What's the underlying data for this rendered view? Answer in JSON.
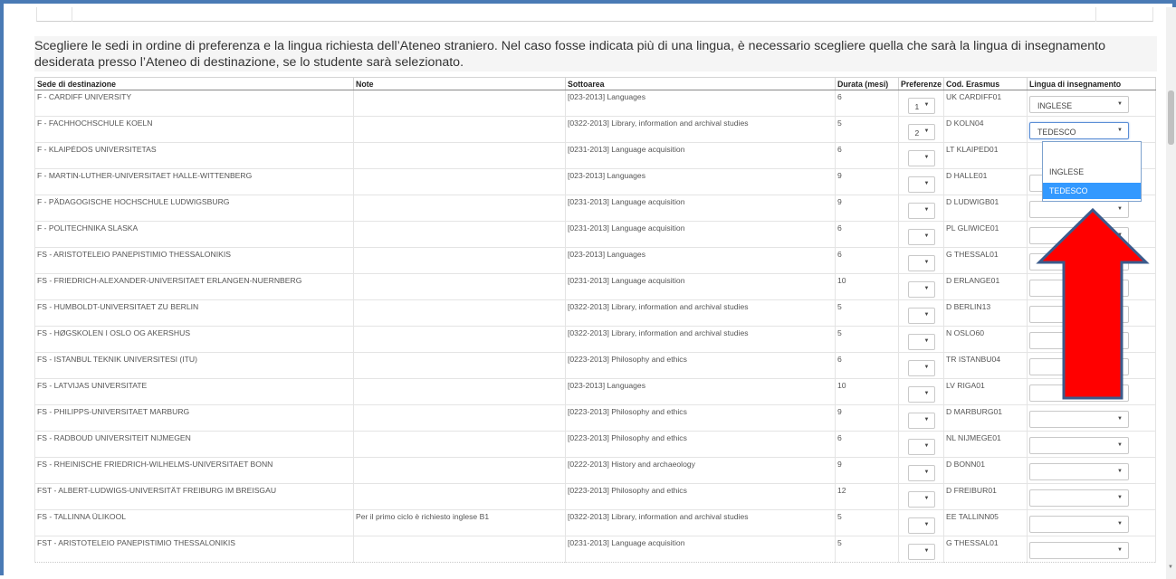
{
  "instructions": "Scegliere le sedi in ordine di preferenza e la lingua richiesta dell’Ateneo straniero. Nel caso fosse indicata più di una lingua, è necessario scegliere quella che sarà la lingua di insegnamento desiderata presso l’Ateneo di destinazione, se lo studente sarà selezionato.",
  "table": {
    "headers": {
      "sede": "Sede di destinazione",
      "note": "Note",
      "sottoarea": "Sottoarea",
      "durata": "Durata (mesi)",
      "preferenze": "Preferenze",
      "cod": "Cod. Erasmus",
      "lingua": "Lingua di insegnamento"
    },
    "rows": [
      {
        "sede": "F - CARDIFF UNIVERSITY",
        "note": "",
        "sottoarea": "[023-2013] Languages",
        "durata": "6",
        "pref": "1",
        "cod": "UK CARDIFF01",
        "lingua": "INGLESE"
      },
      {
        "sede": "F - FACHHOCHSCHULE KOELN",
        "note": "",
        "sottoarea": "[0322-2013] Library, information and archival studies",
        "durata": "5",
        "pref": "2",
        "cod": "D KOLN04",
        "lingua": "TEDESCO"
      },
      {
        "sede": "F - KLAIPĖDOS UNIVERSITETAS",
        "note": "",
        "sottoarea": "[0231-2013] Language acquisition",
        "durata": "6",
        "pref": "",
        "cod": "LT KLAIPED01",
        "lingua": ""
      },
      {
        "sede": "F - MARTIN-LUTHER-UNIVERSITAET HALLE-WITTENBERG",
        "note": "",
        "sottoarea": "[023-2013] Languages",
        "durata": "9",
        "pref": "",
        "cod": "D HALLE01",
        "lingua": ""
      },
      {
        "sede": "F - PÄDAGOGISCHE HOCHSCHULE LUDWIGSBURG",
        "note": "",
        "sottoarea": "[0231-2013] Language acquisition",
        "durata": "9",
        "pref": "",
        "cod": "D LUDWIGB01",
        "lingua": ""
      },
      {
        "sede": "F - POLITECHNIKA SLASKA",
        "note": "",
        "sottoarea": "[0231-2013] Language acquisition",
        "durata": "6",
        "pref": "",
        "cod": "PL GLIWICE01",
        "lingua": ""
      },
      {
        "sede": "FS - ARISTOTELEIO PANEPISTIMIO THESSALONIKIS",
        "note": "",
        "sottoarea": "[023-2013] Languages",
        "durata": "6",
        "pref": "",
        "cod": "G THESSAL01",
        "lingua": ""
      },
      {
        "sede": "FS - FRIEDRICH-ALEXANDER-UNIVERSITAET ERLANGEN-NUERNBERG",
        "note": "",
        "sottoarea": "[0231-2013] Language acquisition",
        "durata": "10",
        "pref": "",
        "cod": "D ERLANGE01",
        "lingua": ""
      },
      {
        "sede": "FS - HUMBOLDT-UNIVERSITAET ZU BERLIN",
        "note": "",
        "sottoarea": "[0322-2013] Library, information and archival studies",
        "durata": "5",
        "pref": "",
        "cod": "D BERLIN13",
        "lingua": ""
      },
      {
        "sede": "FS - HØGSKOLEN I OSLO OG AKERSHUS",
        "note": "",
        "sottoarea": "[0322-2013] Library, information and archival studies",
        "durata": "5",
        "pref": "",
        "cod": "N OSLO60",
        "lingua": ""
      },
      {
        "sede": "FS - ISTANBUL TEKNIK UNIVERSITESI (ITU)",
        "note": "",
        "sottoarea": "[0223-2013] Philosophy and ethics",
        "durata": "6",
        "pref": "",
        "cod": "TR ISTANBU04",
        "lingua": ""
      },
      {
        "sede": "FS - LATVIJAS UNIVERSITATE",
        "note": "",
        "sottoarea": "[023-2013] Languages",
        "durata": "10",
        "pref": "",
        "cod": "LV RIGA01",
        "lingua": ""
      },
      {
        "sede": "FS - PHILIPPS-UNIVERSITAET MARBURG",
        "note": "",
        "sottoarea": "[0223-2013] Philosophy and ethics",
        "durata": "9",
        "pref": "",
        "cod": "D MARBURG01",
        "lingua": ""
      },
      {
        "sede": "FS - RADBOUD UNIVERSITEIT NIJMEGEN",
        "note": "",
        "sottoarea": "[0223-2013] Philosophy and ethics",
        "durata": "6",
        "pref": "",
        "cod": "NL NIJMEGE01",
        "lingua": ""
      },
      {
        "sede": "FS - RHEINISCHE FRIEDRICH-WILHELMS-UNIVERSITAET BONN",
        "note": "",
        "sottoarea": "[0222-2013] History and archaeology",
        "durata": "9",
        "pref": "",
        "cod": "D BONN01",
        "lingua": ""
      },
      {
        "sede": "FST - ALBERT-LUDWIGS-UNIVERSITÄT FREIBURG IM BREISGAU",
        "note": "",
        "sottoarea": "[0223-2013] Philosophy and ethics",
        "durata": "12",
        "pref": "",
        "cod": "D FREIBUR01",
        "lingua": ""
      },
      {
        "sede": "FS - TALLINNA ÜLIKOOL",
        "note": "Per il primo ciclo è richiesto inglese B1",
        "sottoarea": "[0322-2013] Library, information and archival studies",
        "durata": "5",
        "pref": "",
        "cod": "EE TALLINN05",
        "lingua": ""
      },
      {
        "sede": "FST - ARISTOTELEIO PANEPISTIMIO THESSALONIKIS",
        "note": "",
        "sottoarea": "[0231-2013] Language acquisition",
        "durata": "5",
        "pref": "",
        "cod": "G THESSAL01",
        "lingua": ""
      }
    ]
  },
  "dropdown": {
    "options": [
      "INGLESE",
      "TEDESCO"
    ],
    "highlighted": "TEDESCO"
  },
  "icons": {
    "select_arrow": "▼",
    "annotation": "red-up-arrow-icon"
  },
  "colors": {
    "frame": "#4a7ab5",
    "highlight": "#3399ff",
    "arrow_fill": "#ff0000",
    "arrow_stroke": "#3b5b8c"
  }
}
